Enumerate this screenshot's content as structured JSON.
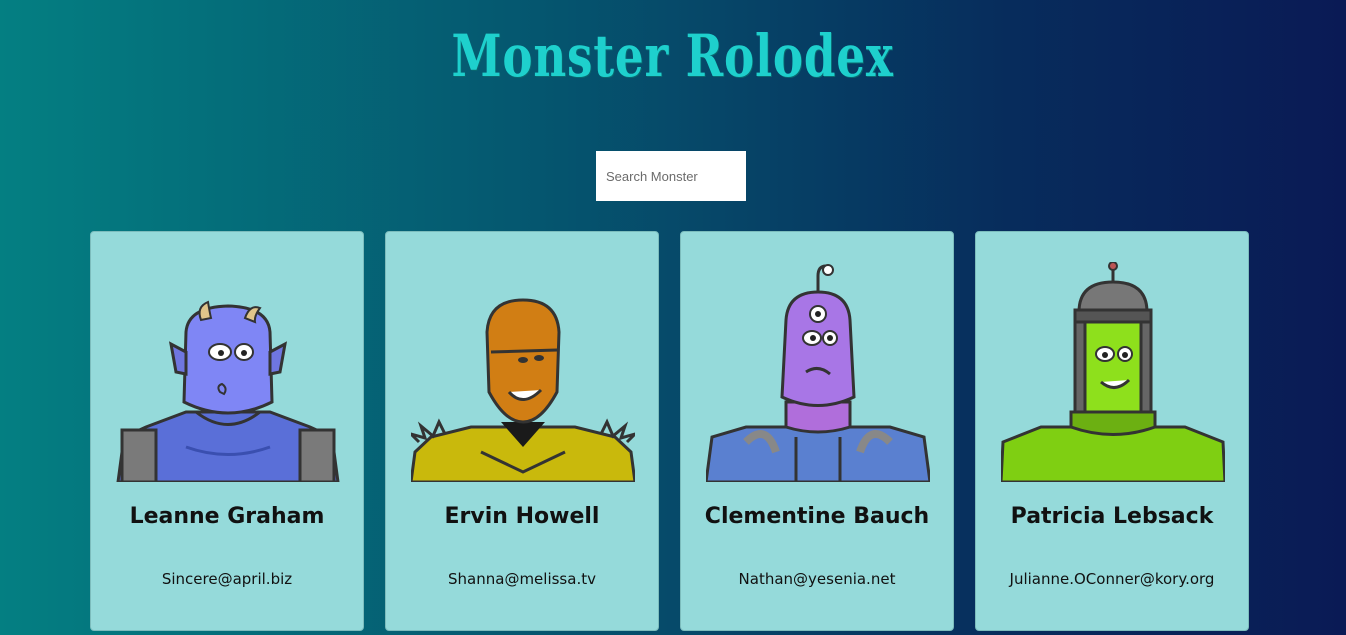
{
  "app": {
    "title": "Monster Rolodex"
  },
  "search": {
    "placeholder": "Search Monster",
    "value": ""
  },
  "monsters": [
    {
      "name": "Leanne Graham",
      "email": "Sincere@april.biz",
      "color": "#7f86f5",
      "avatar": "horned-blue-monster-icon"
    },
    {
      "name": "Ervin Howell",
      "email": "Shanna@melissa.tv",
      "color": "#d1b80e",
      "avatar": "orange-spiky-monster-icon"
    },
    {
      "name": "Clementine Bauch",
      "email": "Nathan@yesenia.net",
      "color": "#a876e6",
      "avatar": "cyclops-robot-monster-icon"
    },
    {
      "name": "Patricia Lebsack",
      "email": "Julianne.OConner@kory.org",
      "color": "#7fcf12",
      "avatar": "frankenstein-monster-icon"
    }
  ],
  "colors": {
    "title": "#1ed0cd",
    "card_background": "#95dada",
    "background_start": "#047f82",
    "background_end": "#0a1a55"
  }
}
